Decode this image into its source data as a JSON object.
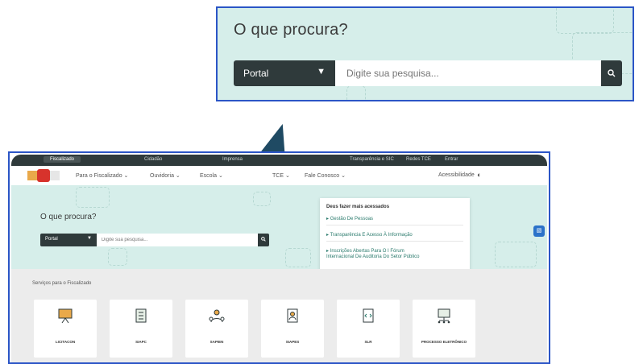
{
  "zoom": {
    "title": "O que procura?",
    "select_value": "Portal",
    "search_placeholder": "Digite sua pesquisa...",
    "search_icon": "search-icon"
  },
  "topbar": {
    "tabs": [
      "Fiscalizado",
      "Cidadão",
      "Imprensa"
    ],
    "right_links": [
      "Transparência e SIC",
      "Redes TCE",
      "Entrar"
    ]
  },
  "nav": {
    "items": [
      "Para o Fiscalizado",
      "Ouvidoria",
      "Escola",
      "TCE",
      "Fale Conosco"
    ],
    "accessibility": "Acessibilidade",
    "contrast_icon": "contrast-icon"
  },
  "hero": {
    "title": "O que procura?",
    "select_value": "Portal",
    "search_placeholder": "Digite sua pesquisa..."
  },
  "popular": {
    "heading": "Deus fazer mais acessados",
    "links": [
      "Gestão De Pessoas",
      "Transparência E Acesso À Informação",
      "Inscrições Abertas Para O I Fórum",
      "Internacional De Auditoria Do Setor Público"
    ]
  },
  "services": {
    "title": "Serviços para o Fiscalizado",
    "cards": [
      "LICITACON",
      "SIAPC",
      "SAPIEN",
      "SIAPES",
      "SLR",
      "PROCESSO ELETRÔNICO"
    ]
  },
  "colors": {
    "hero_bg": "#d6eeea",
    "dark": "#2f3a3b",
    "frame_border": "#2b55c6",
    "link": "#2a7a6c",
    "arrow": "#1f4a63"
  }
}
